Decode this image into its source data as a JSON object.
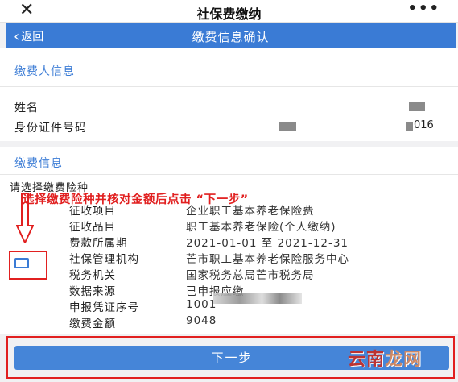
{
  "top_bar": {
    "close_icon": "close-icon",
    "title": "社保费缴纳",
    "more_icon": "more-icon",
    "more_text": "•••"
  },
  "nav_bar": {
    "back_label": "返回",
    "back_icon": "chevron-left-icon",
    "title": "缴费信息确认"
  },
  "payer_section": {
    "title": "缴费人信息",
    "name_label": "姓名",
    "id_label": "身份证件号码",
    "id_tail": "016"
  },
  "payment_section": {
    "title": "缴费信息",
    "prompt": "请选择缴费险种",
    "rows": [
      {
        "label": "征收项目",
        "value": "企业职工基本养老保险费"
      },
      {
        "label": "征收品目",
        "value": "职工基本养老保险(个人缴纳)"
      },
      {
        "label": "费款所属期",
        "value": "2021-01-01 至 2021-12-31"
      },
      {
        "label": "社保管理机构",
        "value": "芒市职工基本养老保险服务中心"
      },
      {
        "label": "税务机关",
        "value": "国家税务总局芒市税务局"
      },
      {
        "label": "数据来源",
        "value": "已申报应缴"
      },
      {
        "label": "申报凭证序号",
        "value": "1001"
      },
      {
        "label": "缴费金额",
        "value": "9048"
      }
    ]
  },
  "annotation": {
    "text": "选择缴费险种并核对金额后点击 “下一步”",
    "color": "#e12020"
  },
  "next_button": {
    "label": "下一步"
  },
  "watermark": {
    "part1": "云南",
    "part2": "龙网"
  },
  "colors": {
    "accent": "#3a7bd5",
    "annotation": "#e12020"
  }
}
